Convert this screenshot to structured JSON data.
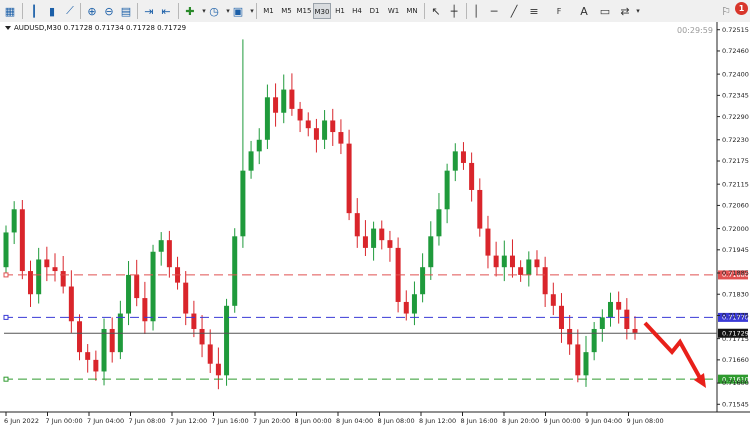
{
  "toolbar": {
    "timeframes": [
      "M1",
      "M5",
      "M15",
      "M30",
      "H1",
      "H4",
      "D1",
      "W1",
      "MN"
    ],
    "active_timeframe": "M30",
    "notification_count": "1"
  },
  "chart": {
    "info": "AUDUSD,M30  0.71728 0.71734 0.71728 0.71729",
    "timer": "00:29:59",
    "price_labels": [
      "0.72515",
      "0.72460",
      "0.72400",
      "0.72345",
      "0.72290",
      "0.72230",
      "0.72175",
      "0.72115",
      "0.72060",
      "0.72000",
      "0.71945",
      "0.71885",
      "0.71830",
      "0.71775",
      "0.71715",
      "0.71660",
      "0.71600",
      "0.71545"
    ],
    "time_labels": [
      "6 Jun 2022",
      "7 Jun 00:00",
      "7 Jun 04:00",
      "7 Jun 08:00",
      "7 Jun 12:00",
      "7 Jun 16:00",
      "7 Jun 20:00",
      "8 Jun 00:00",
      "8 Jun 04:00",
      "8 Jun 08:00",
      "8 Jun 12:00",
      "8 Jun 16:00",
      "8 Jun 20:00",
      "9 Jun 00:00",
      "9 Jun 04:00",
      "9 Jun 08:00"
    ],
    "level_lines": [
      {
        "price": 0.7188,
        "label": "0.71880",
        "color": "#e05050",
        "style": "dashed"
      },
      {
        "price": 0.7177,
        "label": "0.71770",
        "color": "#3a3ad6",
        "style": "dashed"
      },
      {
        "price": 0.71729,
        "label": "0.71729",
        "color": "#555555",
        "style": "solid"
      },
      {
        "price": 0.7161,
        "label": "0.71610",
        "color": "#2e9a2e",
        "style": "dashed"
      }
    ],
    "colors": {
      "bull": "#1f9a3b",
      "bear": "#d9252b",
      "arrow": "#e8201a"
    }
  },
  "chart_data": {
    "type": "candlestick",
    "symbol": "AUDUSD",
    "timeframe": "M30",
    "ylim": [
      0.7154,
      0.7253
    ],
    "candles_close_approx": [
      0.7199,
      0.7205,
      0.7189,
      0.7183,
      0.7192,
      0.719,
      0.7189,
      0.7185,
      0.7176,
      0.7168,
      0.7166,
      0.7163,
      0.7174,
      0.7168,
      0.7178,
      0.7188,
      0.7182,
      0.7176,
      0.7194,
      0.7197,
      0.719,
      0.7186,
      0.7178,
      0.7174,
      0.717,
      0.7165,
      0.7162,
      0.718,
      0.7198,
      0.7215,
      0.722,
      0.7223,
      0.7234,
      0.723,
      0.7236,
      0.7231,
      0.7228,
      0.7226,
      0.7223,
      0.7228,
      0.7225,
      0.7222,
      0.7204,
      0.7198,
      0.7195,
      0.72,
      0.7197,
      0.7195,
      0.7181,
      0.7178,
      0.7183,
      0.719,
      0.7198,
      0.7205,
      0.7215,
      0.722,
      0.7217,
      0.721,
      0.72,
      0.7193,
      0.719,
      0.7193,
      0.719,
      0.7188,
      0.7192,
      0.719,
      0.7183,
      0.718,
      0.7174,
      0.717,
      0.7162,
      0.7168,
      0.7174,
      0.7177,
      0.7181,
      0.7179,
      0.7174,
      0.7173
    ]
  }
}
